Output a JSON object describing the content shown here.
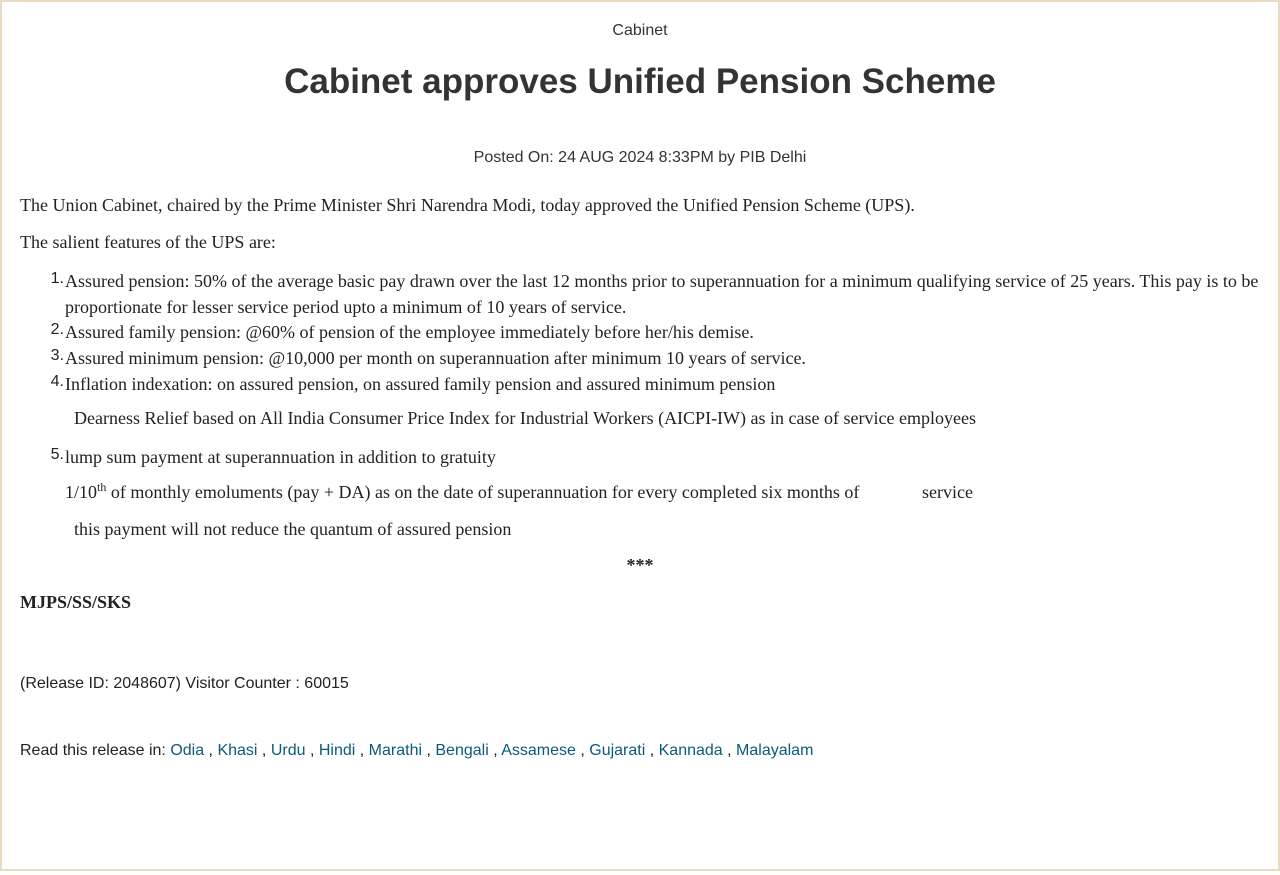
{
  "header": {
    "ministry": "Cabinet",
    "title": "Cabinet approves Unified Pension Scheme",
    "posted": "Posted On: 24 AUG 2024 8:33PM by PIB Delhi"
  },
  "body": {
    "intro": "The Union Cabinet, chaired by the Prime Minister Shri Narendra Modi, today approved the Unified Pension Scheme (UPS).",
    "features_heading": "The salient features of the UPS are:",
    "features": [
      "Assured pension: 50% of the average basic pay drawn over the last 12 months prior to superannuation for a minimum qualifying service of 25 years. This pay is to be proportionate for lesser service period upto a minimum of 10 years of service.",
      "Assured family pension: @60% of pension of the employee immediately before her/his demise.",
      "Assured minimum pension: @10,000 per month on superannuation after minimum 10 years of service.",
      "Inflation indexation: on assured pension, on assured family pension and assured minimum pension"
    ],
    "dearness_note": "Dearness Relief based on All India Consumer Price Index for Industrial Workers (AICPI-IW) as in case of service employees",
    "item5": "lump sum payment at superannuation in addition to gratuity",
    "lump_sum_prefix": "1/10",
    "lump_sum_sup": "th",
    "lump_sum_rest": " of monthly emoluments (pay + DA) as on the date of superannuation for every completed six months of",
    "lump_sum_service": "service",
    "lump_sum_note": "this payment will not reduce the quantum of assured pension",
    "stars": "***",
    "signature": "MJPS/SS/SKS"
  },
  "footer": {
    "release": "(Release ID: 2048607) Visitor Counter : 60015",
    "read_in_label": "Read this release in: ",
    "languages": [
      "Odia",
      "Khasi",
      "Urdu",
      "Hindi",
      "Marathi",
      "Bengali",
      "Assamese",
      "Gujarati",
      "Kannada",
      "Malayalam"
    ],
    "separator": " , "
  }
}
